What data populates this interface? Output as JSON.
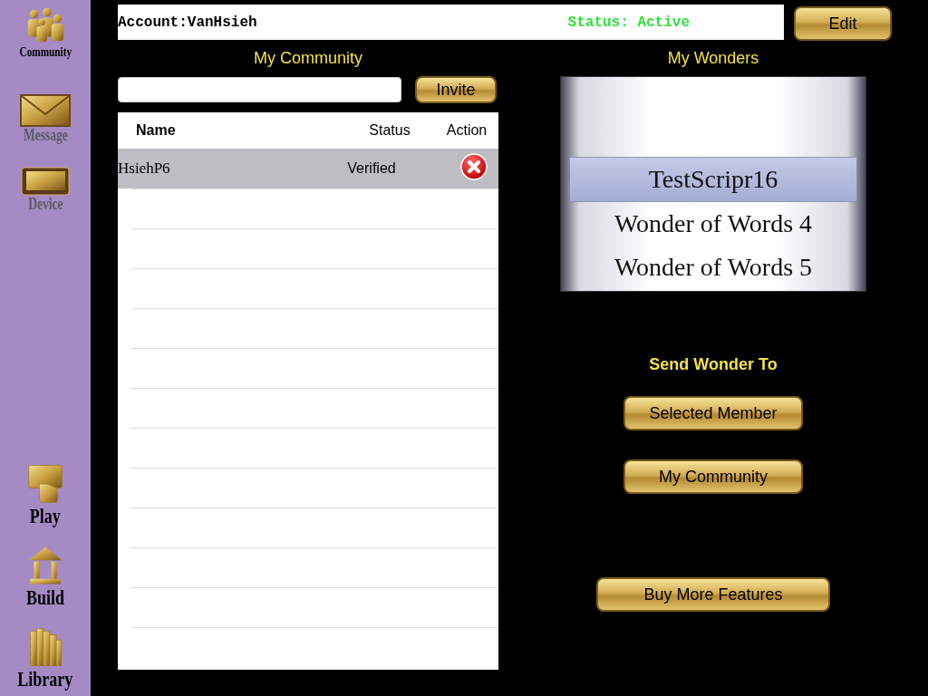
{
  "sidebar": {
    "items": [
      {
        "kind": "community",
        "label": "Community",
        "disabled": false
      },
      {
        "kind": "message",
        "label": "Message",
        "disabled": true
      },
      {
        "kind": "device",
        "label": "Device",
        "disabled": true
      },
      {
        "kind": "play",
        "label": "Play",
        "disabled": false
      },
      {
        "kind": "build",
        "label": "Build",
        "disabled": false
      },
      {
        "kind": "library",
        "label": "Library",
        "disabled": false
      }
    ]
  },
  "account": {
    "name": "Account:VanHsieh",
    "status": "Status: Active",
    "edit_button": "Edit"
  },
  "community": {
    "title": "My Community",
    "invite_button": "Invite",
    "table": {
      "columns": [
        "Name",
        "Status",
        "Action"
      ],
      "rows": [
        {
          "name": "HsiehP6",
          "status": "Verified",
          "selected": true
        }
      ]
    }
  },
  "wonders": {
    "title": "My Wonders",
    "items": [
      {
        "label": "TestScripr16",
        "selected": true
      },
      {
        "label": "Wonder of Words 4",
        "selected": false
      },
      {
        "label": "Wonder of Words 5",
        "selected": false
      }
    ]
  },
  "send": {
    "title": "Send Wonder To",
    "buttons": [
      "Selected Member",
      "My Community"
    ]
  },
  "buy_button": "Buy More Features"
}
